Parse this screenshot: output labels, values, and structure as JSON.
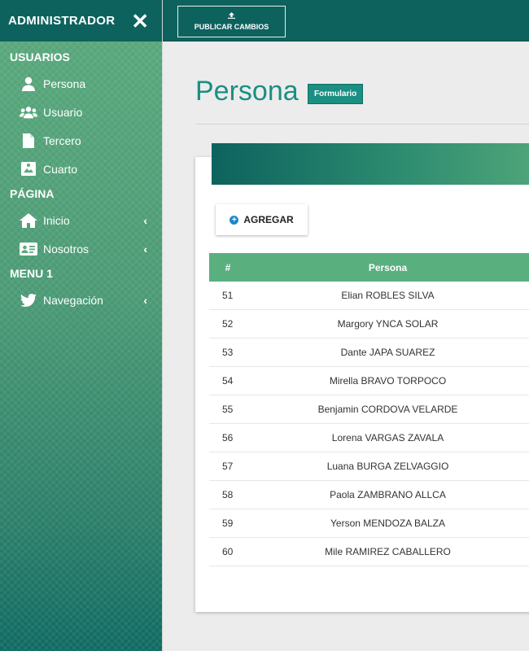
{
  "sidebar": {
    "title": "ADMINISTRADOR",
    "close_icon": "close-icon",
    "sections": [
      {
        "label": "USUARIOS",
        "items": [
          {
            "label": "Persona",
            "icon": "user-icon"
          },
          {
            "label": "Usuario",
            "icon": "users-icon"
          },
          {
            "label": "Tercero",
            "icon": "file-icon"
          },
          {
            "label": "Cuarto",
            "icon": "image-icon"
          }
        ]
      },
      {
        "label": "PÁGINA",
        "items": [
          {
            "label": "Inicio",
            "icon": "home-icon",
            "has_submenu": true
          },
          {
            "label": "Nosotros",
            "icon": "id-card-icon",
            "has_submenu": true
          }
        ]
      },
      {
        "label": "MENU 1",
        "items": [
          {
            "label": "Navegación",
            "icon": "twitter-icon",
            "has_submenu": true
          }
        ]
      }
    ]
  },
  "topbar": {
    "publish_label": "PUBLICAR CAMBIOS",
    "publish_icon": "upload-icon"
  },
  "main": {
    "title": "Persona",
    "badge": "Formulario",
    "add_button": {
      "label": "AGREGAR",
      "icon": "plus-circle-icon"
    },
    "table": {
      "headers": [
        "#",
        "Persona"
      ],
      "rows": [
        {
          "id": "51",
          "name": "Elian ROBLES SILVA"
        },
        {
          "id": "52",
          "name": "Margory YNCA SOLAR"
        },
        {
          "id": "53",
          "name": "Dante JAPA SUAREZ"
        },
        {
          "id": "54",
          "name": "Mirella BRAVO TORPOCO"
        },
        {
          "id": "55",
          "name": "Benjamin CORDOVA VELARDE"
        },
        {
          "id": "56",
          "name": "Lorena VARGAS ZAVALA"
        },
        {
          "id": "57",
          "name": "Luana BURGA ZELVAGGIO"
        },
        {
          "id": "58",
          "name": "Paola ZAMBRANO ALLCA"
        },
        {
          "id": "59",
          "name": "Yerson MENDOZA BALZA"
        },
        {
          "id": "60",
          "name": "Mile RAMIREZ CABALLERO"
        }
      ]
    }
  },
  "colors": {
    "primary_dark": "#0d625e",
    "accent": "#1a8f82",
    "table_header": "#5aaf7f",
    "add_icon": "#1e88c9"
  }
}
